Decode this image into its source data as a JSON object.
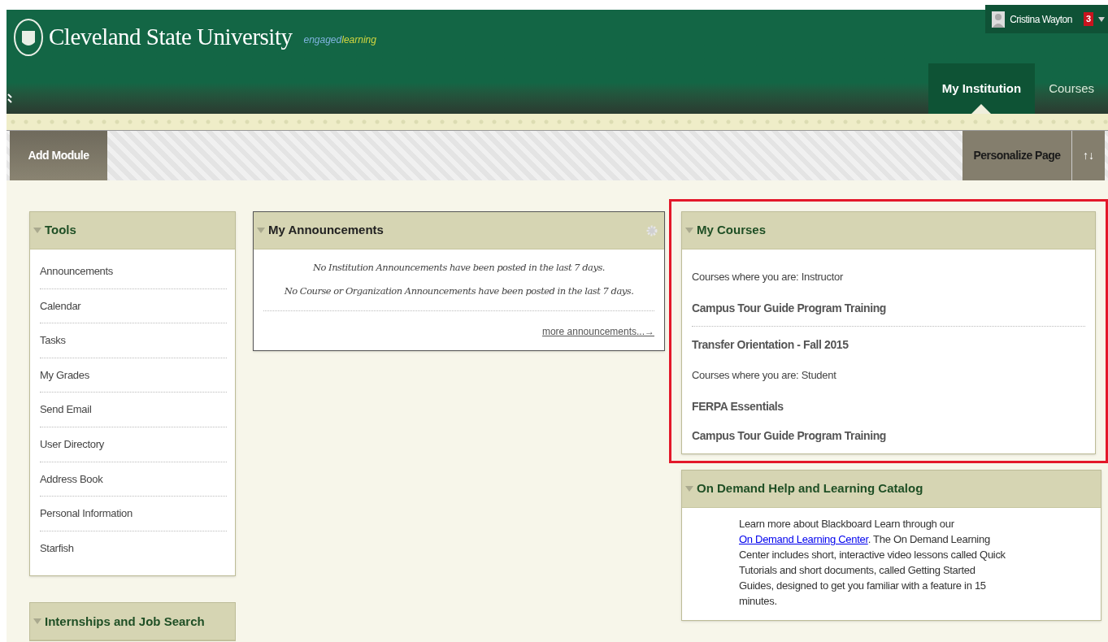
{
  "header": {
    "title": "Cleveland State University",
    "tagline_a": "engaged",
    "tagline_b": "learning",
    "user": "Cristina Wayton",
    "badge": "3"
  },
  "tabs": [
    {
      "label": "My Institution",
      "selected": true
    },
    {
      "label": "Courses",
      "selected": false
    }
  ],
  "toolbar": {
    "add": "Add Module",
    "personalize": "Personalize Page",
    "sort": "↑↓"
  },
  "tools": {
    "title": "Tools",
    "items": [
      "Announcements",
      "Calendar",
      "Tasks",
      "My Grades",
      "Send Email",
      "User Directory",
      "Address Book",
      "Personal Information",
      "Starfish"
    ]
  },
  "internships": {
    "title": "Internships and Job Search"
  },
  "announcements": {
    "title": "My Announcements",
    "messages": [
      "No Institution Announcements have been posted in the last 7 days.",
      "No Course or Organization Announcements have been posted in the last 7 days."
    ],
    "more": "more announcements...→"
  },
  "courses": {
    "title": "My Courses",
    "highlighted": true,
    "entries": [
      {
        "kind": "role",
        "text": "Courses where you are: Instructor"
      },
      {
        "kind": "course",
        "text": "Campus Tour Guide Program Training"
      },
      {
        "kind": "divider"
      },
      {
        "kind": "course",
        "text": "Transfer Orientation - Fall 2015"
      },
      {
        "kind": "role",
        "text": "Courses where you are: Student"
      },
      {
        "kind": "course",
        "text": "FERPA Essentials"
      },
      {
        "kind": "course",
        "text": "Campus Tour Guide Program Training"
      }
    ]
  },
  "catalog": {
    "title": "On Demand Help and Learning Catalog",
    "before": "Learn more about Blackboard Learn through our ",
    "link": "On Demand Learning Center",
    "after": ". The On Demand Learning Center includes short, interactive video lessons called Quick Tutorials and short documents, called Getting Started Guides, designed to get you familiar with a feature in 15 minutes."
  }
}
